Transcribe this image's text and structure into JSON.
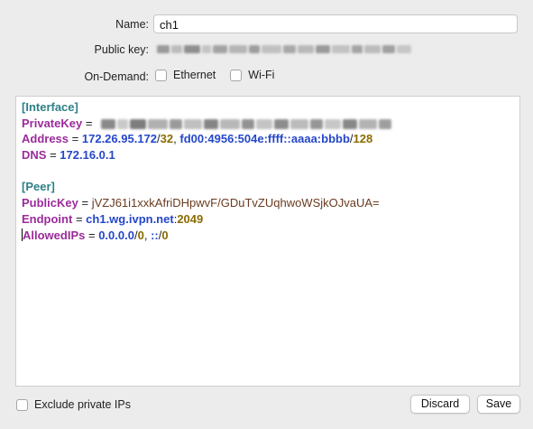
{
  "form": {
    "name_label": "Name:",
    "name_value": "ch1",
    "public_key_label": "Public key:",
    "ondemand_label": "On-Demand:",
    "ondemand_options": [
      {
        "label": "Ethernet",
        "checked": false
      },
      {
        "label": "Wi-Fi",
        "checked": false
      }
    ]
  },
  "config": {
    "interface_header": "[Interface]",
    "private_key_key": "PrivateKey",
    "address_key": "Address",
    "address_ipv4": "172.26.95.172",
    "address_ipv4_cidr": "32",
    "address_ipv6": "fd00:4956:504e:ffff::aaaa:bbbb",
    "address_ipv6_cidr": "128",
    "dns_key": "DNS",
    "dns_value": "172.16.0.1",
    "peer_header": "[Peer]",
    "public_key_key": "PublicKey",
    "public_key_value": "jVZJ61i1xxkAfriDHpwvF/GDuTvZUqhwoWSjkOJvaUA=",
    "endpoint_key": "Endpoint",
    "endpoint_host": "ch1.wg.ivpn.net",
    "endpoint_port": "2049",
    "allowed_ips_key": "AllowedIPs",
    "allowed_ip4": "0.0.0.0",
    "allowed_ip4_cidr": "0",
    "allowed_ip6": "::",
    "allowed_ip6_cidr": "0",
    "eq": "=",
    "slash": "/",
    "comma": ",",
    "colon": ":"
  },
  "footer": {
    "exclude_private_label": "Exclude private IPs",
    "discard_label": "Discard",
    "save_label": "Save"
  },
  "colors": {
    "section": "#2e7f86",
    "key": "#9b2b9b",
    "number": "#2547c9",
    "cidr": "#8a6b00",
    "string": "#6a3a1f"
  }
}
